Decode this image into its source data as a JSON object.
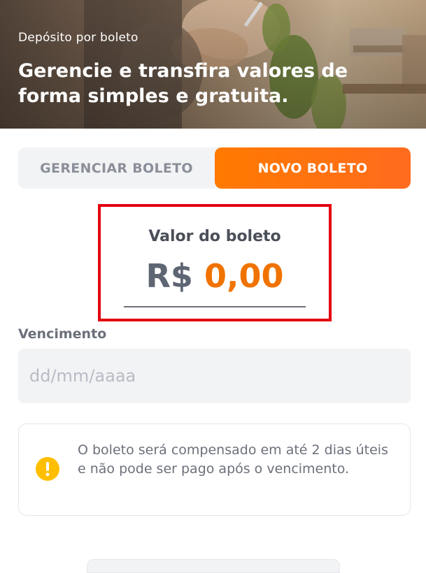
{
  "header": {
    "kicker": "Depósito por boleto",
    "title": "Gerencie e transfira valores de forma simples e gratuita."
  },
  "tabs": {
    "manage_label": "GERENCIAR BOLETO",
    "new_label": "NOVO BOLETO",
    "active": "NOVO BOLETO"
  },
  "amount": {
    "label": "Valor do boleto",
    "currency": "R$",
    "value": "0,00"
  },
  "due_date": {
    "label": "Vencimento",
    "placeholder": "dd/mm/aaaa"
  },
  "info": {
    "icon": "warning-icon",
    "text": "O boleto será compensado em até 2 dias úteis e não pode ser pago após o vencimento."
  },
  "colors": {
    "accent": "#ff6b1e",
    "amount_value": "#f07300",
    "highlight_border": "#e3000f",
    "warning": "#ffbf00"
  }
}
